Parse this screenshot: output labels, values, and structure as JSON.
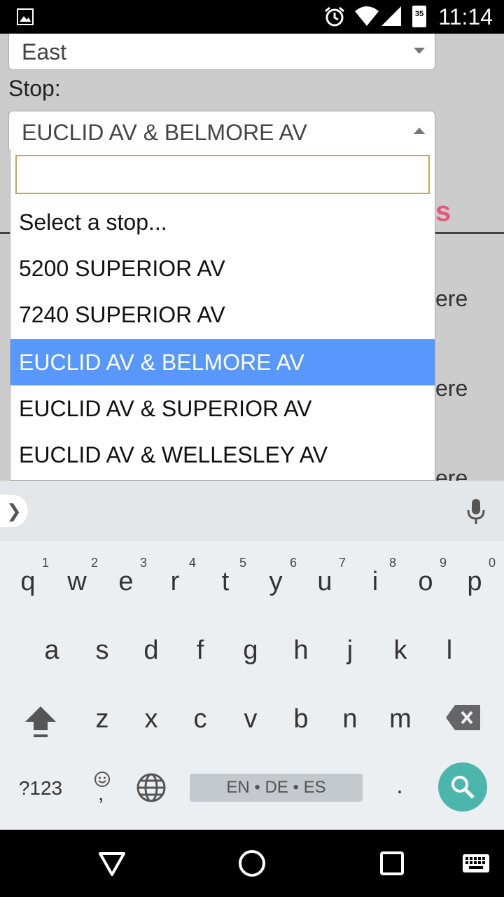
{
  "status_bar": {
    "time": "11:14",
    "battery_level": "35"
  },
  "form": {
    "direction_value": "East",
    "stop_label": "Stop:",
    "stop_value": "EUCLID AV & BELMORE AV"
  },
  "background": {
    "partial_heading": "s",
    "partial_text": [
      "ere",
      "ere",
      "ere"
    ]
  },
  "dropdown": {
    "search_value": "",
    "options": [
      {
        "label": "Select a stop...",
        "selected": false
      },
      {
        "label": "5200 SUPERIOR AV",
        "selected": false
      },
      {
        "label": "7240 SUPERIOR AV",
        "selected": false
      },
      {
        "label": "EUCLID AV & BELMORE AV",
        "selected": true
      },
      {
        "label": "EUCLID AV & SUPERIOR AV",
        "selected": false
      },
      {
        "label": "EUCLID AV & WELLESLEY AV",
        "selected": false
      }
    ]
  },
  "keyboard": {
    "row1": [
      {
        "letter": "q",
        "hint": "1"
      },
      {
        "letter": "w",
        "hint": "2"
      },
      {
        "letter": "e",
        "hint": "3"
      },
      {
        "letter": "r",
        "hint": "4"
      },
      {
        "letter": "t",
        "hint": "5"
      },
      {
        "letter": "y",
        "hint": "6"
      },
      {
        "letter": "u",
        "hint": "7"
      },
      {
        "letter": "i",
        "hint": "8"
      },
      {
        "letter": "o",
        "hint": "9"
      },
      {
        "letter": "p",
        "hint": "0"
      }
    ],
    "row2": [
      "a",
      "s",
      "d",
      "f",
      "g",
      "h",
      "j",
      "k",
      "l"
    ],
    "row3": [
      "z",
      "x",
      "c",
      "v",
      "b",
      "n",
      "m"
    ],
    "symbols_label": "?123",
    "space_label": "EN • DE • ES",
    "period_label": ".",
    "comma_label": ","
  },
  "colors": {
    "selected_option": "#5897fb",
    "search_key": "#4db6ac",
    "input_border": "#cda34b",
    "accent_pink": "#e8547e"
  }
}
